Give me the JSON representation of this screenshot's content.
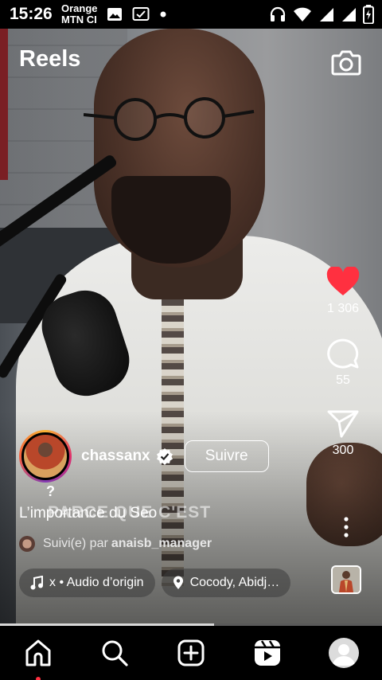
{
  "status_bar": {
    "time": "15:26",
    "carrier_line1": "Orange",
    "carrier_line2": "MTN CI",
    "icons": [
      "image-icon",
      "check-box-icon",
      "dot-icon",
      "headset-icon",
      "wifi-icon",
      "signal-icon",
      "signal-icon",
      "battery-charging-icon"
    ]
  },
  "header": {
    "title": "Reels",
    "camera_icon": "camera-icon"
  },
  "reel": {
    "author": {
      "username": "chassanx",
      "verified": true,
      "follow_label": "Suivre"
    },
    "question_mark": "?",
    "burned_subtitle": "PARCE QUE C'EST",
    "caption": "L’importance du Seo",
    "followed_by_prefix": "Suivi(e) par",
    "followed_by_user": "anaisb_manager",
    "audio_label": "x • Audio d’origin",
    "location_label": "Cocody, Abidj…",
    "progress_fraction": 0.56
  },
  "actions": {
    "likes": "1 306",
    "comments": "55",
    "shares": "300"
  },
  "colors": {
    "like_red": "#ff3040",
    "background": "#000000"
  },
  "nav": {
    "items": [
      "home-icon",
      "search-icon",
      "create-icon",
      "reels-icon",
      "profile-avatar"
    ]
  }
}
